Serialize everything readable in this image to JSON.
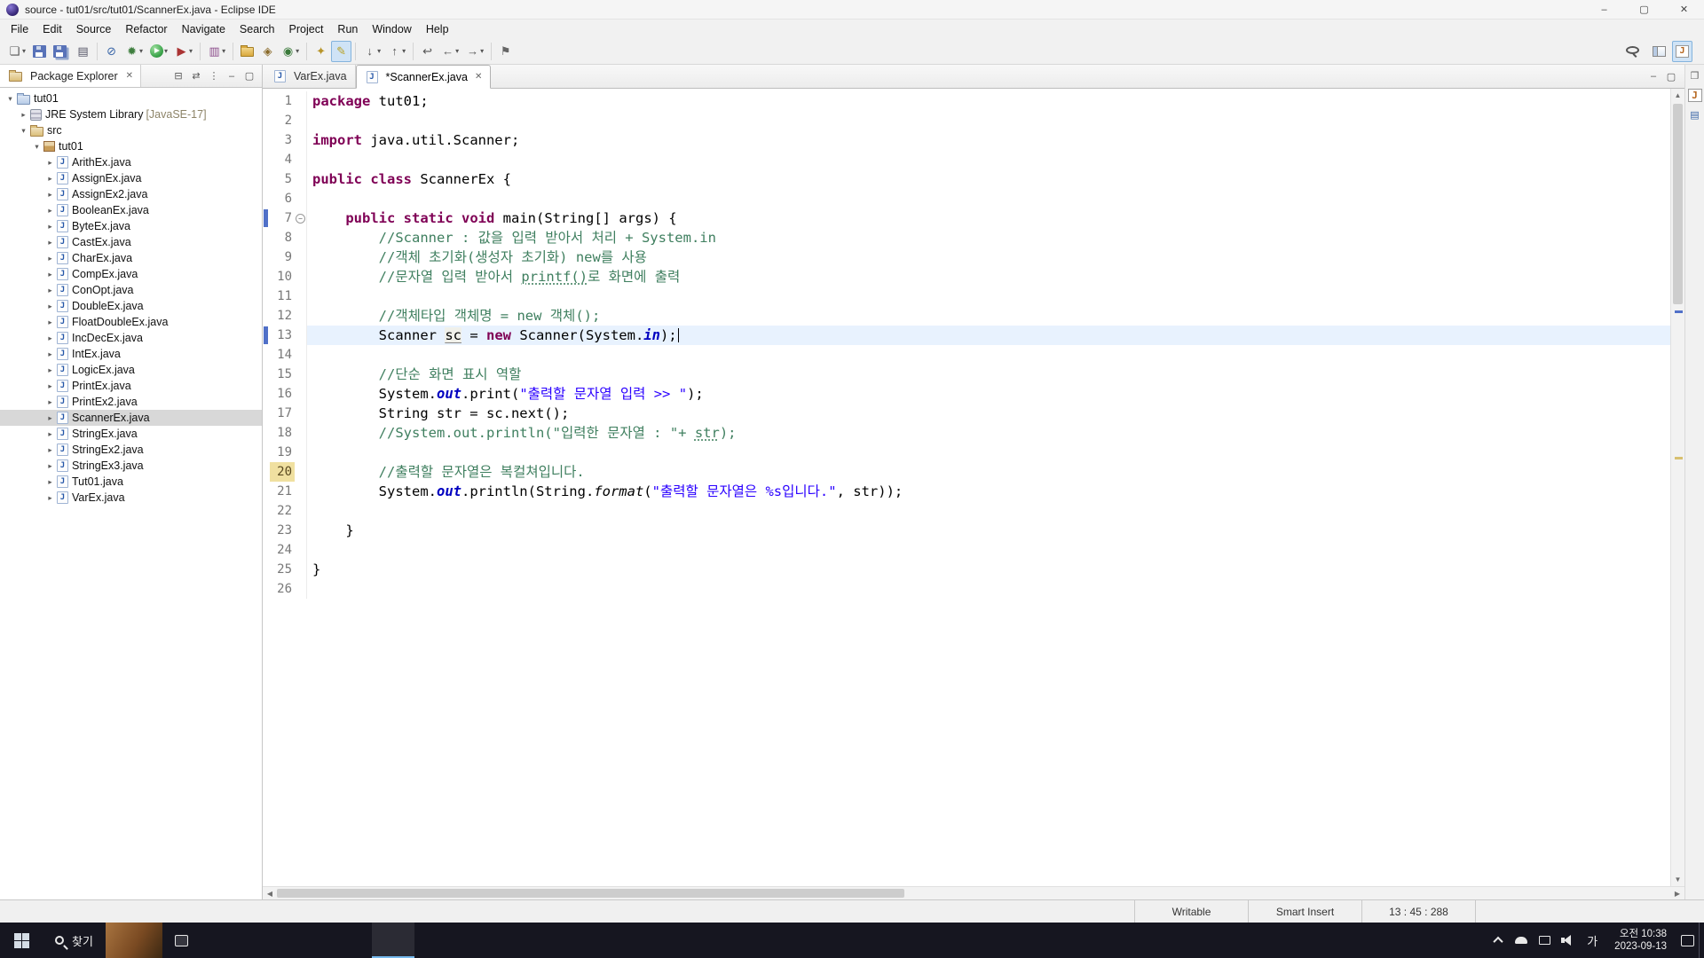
{
  "glyphs": {
    "expand": "▸",
    "collapse": "▾",
    "dropdown": "▾",
    "close": "✕",
    "fold_minus": "−",
    "vup": "▲",
    "vdown": "▼",
    "hleft": "◀",
    "hright": "▶"
  },
  "window": {
    "title": "source - tut01/src/tut01/ScannerEx.java - Eclipse IDE",
    "controls": [
      {
        "name": "minimize-window",
        "glyph": "–"
      },
      {
        "name": "maximize-window",
        "glyph": "▢"
      },
      {
        "name": "close-window",
        "glyph": "✕"
      }
    ]
  },
  "menu": [
    "File",
    "Edit",
    "Source",
    "Refactor",
    "Navigate",
    "Search",
    "Project",
    "Run",
    "Window",
    "Help"
  ],
  "toolbar": {
    "groups": [
      [
        {
          "name": "new-wizard",
          "glyph": "❏",
          "color": "#555555",
          "dd": true
        },
        {
          "name": "save",
          "cls": "ti-save"
        },
        {
          "name": "save-all",
          "cls": "ti-save ti-saveall"
        },
        {
          "name": "print",
          "glyph": "▤",
          "color": "#555566"
        }
      ],
      [
        {
          "name": "skip-breakpoints",
          "glyph": "⊘",
          "color": "#3a66a8"
        },
        {
          "name": "debug",
          "glyph": "✹",
          "color": "#3f7f3f",
          "dd": true
        },
        {
          "name": "run",
          "cls": "ti-run",
          "dd": true
        },
        {
          "name": "external-tools",
          "glyph": "▶",
          "color": "#aa3333",
          "dd": true
        }
      ],
      [
        {
          "name": "coverage",
          "glyph": "▥",
          "color": "#8a4a8a",
          "dd": true
        }
      ],
      [
        {
          "name": "new-java-project",
          "cls": "ti-folder"
        },
        {
          "name": "new-package",
          "glyph": "◈",
          "color": "#8a6a2a"
        },
        {
          "name": "new-class",
          "glyph": "◉",
          "color": "#3a7a3a",
          "dd": true
        }
      ],
      [
        {
          "name": "search-flashlight",
          "glyph": "✦",
          "color": "#b8952a"
        },
        {
          "name": "mark-occurrences",
          "glyph": "✎",
          "color": "#b8a020",
          "pressed": true
        }
      ],
      [
        {
          "name": "next-annotation",
          "glyph": "↓",
          "color": "#555555",
          "dd": true
        },
        {
          "name": "previous-annotation",
          "glyph": "↑",
          "color": "#555555",
          "dd": true
        }
      ],
      [
        {
          "name": "last-edit-location",
          "glyph": "↩",
          "color": "#555555"
        },
        {
          "name": "back",
          "glyph": "←",
          "color": "#555555",
          "dd": true
        },
        {
          "name": "forward",
          "glyph": "→",
          "color": "#555555",
          "dd": true
        }
      ],
      [
        {
          "name": "pin-editor",
          "glyph": "⚑",
          "color": "#666666"
        }
      ]
    ],
    "right": [
      {
        "name": "quick-search",
        "cls": "ti-mag"
      },
      {
        "name": "open-perspective",
        "cls": "ti-persp"
      },
      {
        "name": "java-perspective",
        "glyph": "J",
        "color": "#b5651d",
        "cls": "ti-javabox",
        "pressed": true
      }
    ]
  },
  "package_explorer": {
    "title": "Package Explorer",
    "header_icons": [
      {
        "name": "collapse-all",
        "glyph": "⊟"
      },
      {
        "name": "link-with-editor",
        "glyph": "⇄"
      },
      {
        "name": "view-menu",
        "glyph": "⋮"
      },
      {
        "name": "minimize-view",
        "glyph": "–"
      },
      {
        "name": "maximize-view",
        "glyph": "▢"
      }
    ],
    "tree": [
      {
        "label": "tut01",
        "icon": "project",
        "depth": 0,
        "exp": true
      },
      {
        "label": "JRE System Library",
        "suffix": "[JavaSE-17]",
        "icon": "library",
        "depth": 1,
        "exp": false
      },
      {
        "label": "src",
        "icon": "src",
        "depth": 1,
        "exp": true
      },
      {
        "label": "tut01",
        "icon": "package",
        "depth": 2,
        "exp": true
      },
      {
        "label": "ArithEx.java",
        "icon": "jfile",
        "depth": 3,
        "exp": false
      },
      {
        "label": "AssignEx.java",
        "icon": "jfile",
        "depth": 3,
        "exp": false
      },
      {
        "label": "AssignEx2.java",
        "icon": "jfile",
        "depth": 3,
        "exp": false
      },
      {
        "label": "BooleanEx.java",
        "icon": "jfile",
        "depth": 3,
        "exp": false
      },
      {
        "label": "ByteEx.java",
        "icon": "jfile",
        "depth": 3,
        "exp": false
      },
      {
        "label": "CastEx.java",
        "icon": "jfile",
        "depth": 3,
        "exp": false
      },
      {
        "label": "CharEx.java",
        "icon": "jfile",
        "depth": 3,
        "exp": false
      },
      {
        "label": "CompEx.java",
        "icon": "jfile",
        "depth": 3,
        "exp": false
      },
      {
        "label": "ConOpt.java",
        "icon": "jfile",
        "depth": 3,
        "exp": false
      },
      {
        "label": "DoubleEx.java",
        "icon": "jfile",
        "depth": 3,
        "exp": false
      },
      {
        "label": "FloatDoubleEx.java",
        "icon": "jfile",
        "depth": 3,
        "exp": false
      },
      {
        "label": "IncDecEx.java",
        "icon": "jfile",
        "depth": 3,
        "exp": false
      },
      {
        "label": "IntEx.java",
        "icon": "jfile",
        "depth": 3,
        "exp": false
      },
      {
        "label": "LogicEx.java",
        "icon": "jfile",
        "depth": 3,
        "exp": false
      },
      {
        "label": "PrintEx.java",
        "icon": "jfile",
        "depth": 3,
        "exp": false
      },
      {
        "label": "PrintEx2.java",
        "icon": "jfile",
        "depth": 3,
        "exp": false
      },
      {
        "label": "ScannerEx.java",
        "icon": "jfile",
        "depth": 3,
        "exp": false,
        "selected": true
      },
      {
        "label": "StringEx.java",
        "icon": "jfile",
        "depth": 3,
        "exp": false
      },
      {
        "label": "StringEx2.java",
        "icon": "jfile",
        "depth": 3,
        "exp": false
      },
      {
        "label": "StringEx3.java",
        "icon": "jfile",
        "depth": 3,
        "exp": false
      },
      {
        "label": "Tut01.java",
        "icon": "jfile",
        "depth": 3,
        "exp": false
      },
      {
        "label": "VarEx.java",
        "icon": "jfile",
        "depth": 3,
        "exp": false
      }
    ]
  },
  "tabs": [
    {
      "label": "VarEx.java",
      "active": false
    },
    {
      "label": "*ScannerEx.java",
      "active": true
    }
  ],
  "editor_actions": [
    {
      "name": "minimize-editor",
      "glyph": "–"
    },
    {
      "name": "maximize-editor",
      "glyph": "▢"
    }
  ],
  "editor": {
    "current_line": 13,
    "lines": [
      {
        "n": 1,
        "segs": [
          [
            "kw",
            "package"
          ],
          [
            "pl",
            " tut01;"
          ]
        ]
      },
      {
        "n": 2,
        "segs": []
      },
      {
        "n": 3,
        "segs": [
          [
            "kw",
            "import"
          ],
          [
            "pl",
            " java.util.Scanner;"
          ]
        ]
      },
      {
        "n": 4,
        "segs": []
      },
      {
        "n": 5,
        "segs": [
          [
            "kw",
            "public"
          ],
          [
            "pl",
            " "
          ],
          [
            "kw",
            "class"
          ],
          [
            "pl",
            " ScannerEx {"
          ]
        ]
      },
      {
        "n": 6,
        "segs": []
      },
      {
        "n": 7,
        "fold": true,
        "mark": true,
        "segs": [
          [
            "pl",
            "    "
          ],
          [
            "kw",
            "public"
          ],
          [
            "pl",
            " "
          ],
          [
            "kw",
            "static"
          ],
          [
            "pl",
            " "
          ],
          [
            "kw",
            "void"
          ],
          [
            "pl",
            " main(String[] args) {"
          ]
        ]
      },
      {
        "n": 8,
        "segs": [
          [
            "pl",
            "        "
          ],
          [
            "com",
            "//Scanner : 값을 입력 받아서 처리 + System.in"
          ]
        ]
      },
      {
        "n": 9,
        "segs": [
          [
            "pl",
            "        "
          ],
          [
            "com",
            "//객체 초기화(생성자 초기화) new를 사용"
          ]
        ]
      },
      {
        "n": 10,
        "segs": [
          [
            "pl",
            "        "
          ],
          [
            "com",
            "//문자열 입력 받아서 "
          ],
          [
            "comu",
            "printf()"
          ],
          [
            "com",
            "로 화면에 출력"
          ]
        ]
      },
      {
        "n": 11,
        "segs": []
      },
      {
        "n": 12,
        "segs": [
          [
            "pl",
            "        "
          ],
          [
            "com",
            "//객체타입 객체명 = new 객체();"
          ]
        ]
      },
      {
        "n": 13,
        "mark": true,
        "caret": true,
        "segs": [
          [
            "pl",
            "        Scanner "
          ],
          [
            "plu",
            "sc"
          ],
          [
            "pl",
            " = "
          ],
          [
            "kw",
            "new"
          ],
          [
            "pl",
            " Scanner(System."
          ],
          [
            "fld",
            "in"
          ],
          [
            "pl",
            ");"
          ]
        ]
      },
      {
        "n": 14,
        "segs": []
      },
      {
        "n": 15,
        "segs": [
          [
            "pl",
            "        "
          ],
          [
            "com",
            "//단순 화면 표시 역할"
          ]
        ]
      },
      {
        "n": 16,
        "segs": [
          [
            "pl",
            "        System."
          ],
          [
            "fld",
            "out"
          ],
          [
            "pl",
            ".print("
          ],
          [
            "str",
            "\"출력할 문자열 입력 >> \""
          ],
          [
            "pl",
            ");"
          ]
        ]
      },
      {
        "n": 17,
        "segs": [
          [
            "pl",
            "        String str = sc.next();"
          ]
        ]
      },
      {
        "n": 18,
        "segs": [
          [
            "pl",
            "        "
          ],
          [
            "com",
            "//System.out.println(\"입력한 문자열 : \"+ "
          ],
          [
            "comu",
            "str"
          ],
          [
            "com",
            ");"
          ]
        ]
      },
      {
        "n": 19,
        "segs": []
      },
      {
        "n": 20,
        "numhl": true,
        "segs": [
          [
            "pl",
            "        "
          ],
          [
            "com",
            "//출력할 문자열은 복컬쳐입니다."
          ]
        ]
      },
      {
        "n": 21,
        "segs": [
          [
            "pl",
            "        System."
          ],
          [
            "fld",
            "out"
          ],
          [
            "pl",
            ".println(String."
          ],
          [
            "sm",
            "format"
          ],
          [
            "pl",
            "("
          ],
          [
            "str",
            "\"출력할 문자열은 %s입니다.\""
          ],
          [
            "pl",
            ", str));"
          ]
        ]
      },
      {
        "n": 22,
        "segs": []
      },
      {
        "n": 23,
        "segs": [
          [
            "pl",
            "    }"
          ]
        ]
      },
      {
        "n": 24,
        "segs": []
      },
      {
        "n": 25,
        "segs": [
          [
            "pl",
            "}"
          ]
        ]
      },
      {
        "n": 26,
        "segs": []
      }
    ]
  },
  "status": {
    "writable": "Writable",
    "insert_mode": "Smart Insert",
    "position": "13 : 45 : 288"
  },
  "right_strip": [
    {
      "name": "restore-views",
      "glyph": "❐",
      "color": "#666666"
    },
    {
      "name": "minimized-java-view",
      "glyph": "J",
      "color": "#b5651d",
      "cls": "ti-javabox"
    },
    {
      "name": "minimized-view",
      "glyph": "▤",
      "color": "#3a66a8"
    }
  ],
  "taskbar": {
    "search_label": "찾기",
    "ime": "가",
    "time": "오전 10:38",
    "date": "2023-09-13",
    "apps": [
      {
        "name": "edge-browser",
        "cls": "app-edge"
      },
      {
        "name": "file-explorer",
        "cls": "app-explorer"
      },
      {
        "name": "chrome-browser",
        "cls": "app-chrome"
      },
      {
        "name": "green-app",
        "cls": "app-green"
      },
      {
        "name": "eclipse-ide",
        "cls": "app-eclipse",
        "active": true
      },
      {
        "name": "purple-app",
        "cls": "app-purple"
      }
    ]
  }
}
